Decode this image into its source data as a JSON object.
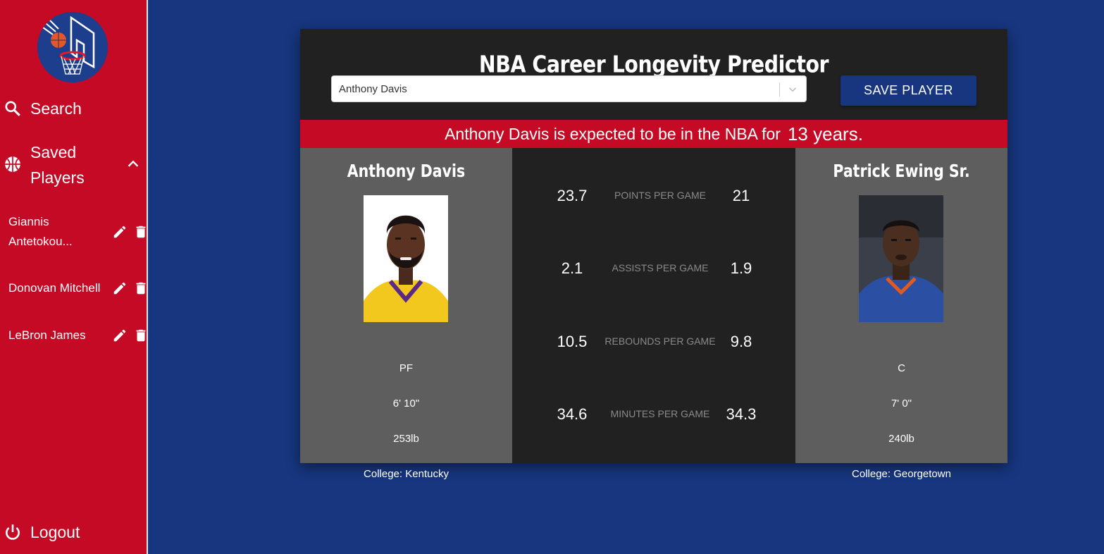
{
  "sidebar": {
    "search_label": "Search",
    "saved_label_line1": "Saved",
    "saved_label_line2": "Players",
    "saved_players": [
      {
        "name_line1": "Giannis",
        "name_line2": "Antetokou..."
      },
      {
        "name_line1": "Donovan Mitchell"
      },
      {
        "name_line1": "LeBron James"
      }
    ],
    "logout_label": "Logout"
  },
  "card": {
    "title": "NBA Career Longevity Predictor",
    "select_value": "Anthony Davis",
    "save_label": "SAVE PLAYER",
    "banner_text": "Anthony Davis is expected to be in the NBA for",
    "banner_years": "13 years."
  },
  "left_player": {
    "name": "Anthony Davis",
    "position": "PF",
    "height": "6' 10\"",
    "weight": "253lb",
    "college": "College: Kentucky"
  },
  "right_player": {
    "name": "Patrick Ewing Sr.",
    "position": "C",
    "height": "7' 0\"",
    "weight": "240lb",
    "college": "College: Georgetown"
  },
  "stats": [
    {
      "left": "23.7",
      "label": "POINTS PER GAME",
      "right": "21"
    },
    {
      "left": "2.1",
      "label": "ASSISTS PER GAME",
      "right": "1.9"
    },
    {
      "left": "10.5",
      "label": "REBOUNDS PER GAME",
      "right": "9.8"
    },
    {
      "left": "34.6",
      "label": "MINUTES PER GAME",
      "right": "34.3"
    }
  ],
  "colors": {
    "background": "#17367f",
    "sidebar": "#c40a24",
    "card": "#222122",
    "panel": "#5e5e5e",
    "banner": "#c40a24"
  }
}
